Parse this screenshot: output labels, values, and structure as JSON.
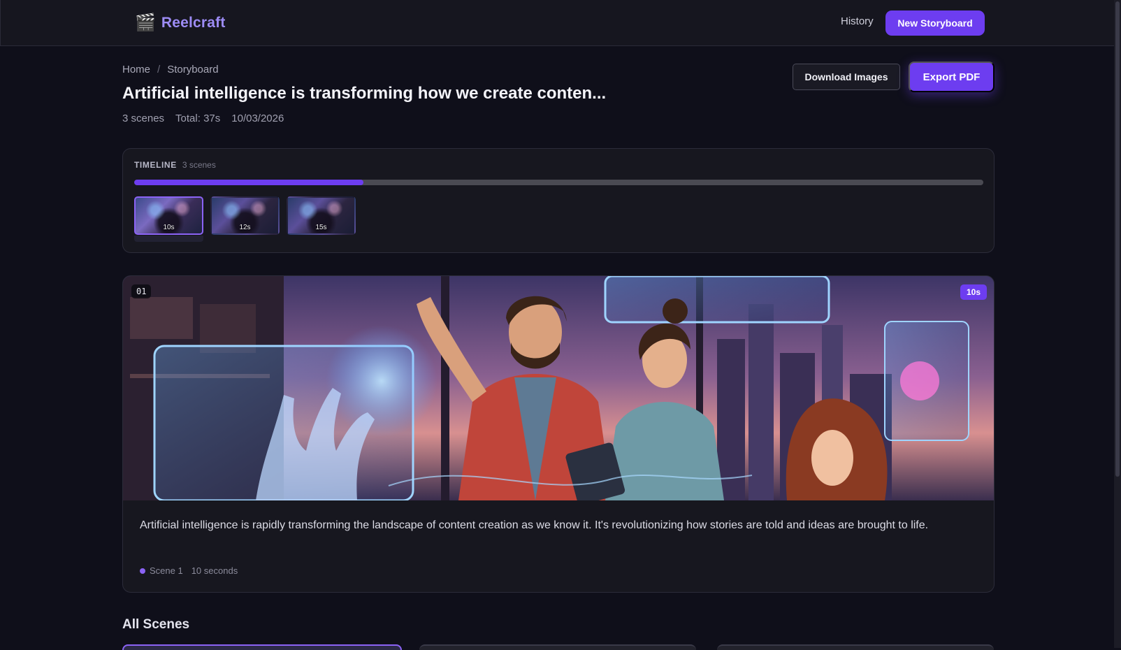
{
  "header": {
    "brand_icon": "🎬",
    "brand_name": "Reelcraft",
    "nav_history": "History",
    "new_storyboard": "New Storyboard"
  },
  "breadcrumb": {
    "home": "Home",
    "separator": "/",
    "current": "Storyboard"
  },
  "storyboard": {
    "title": "Artificial intelligence is transforming how we create conten...",
    "scene_count": "3 scenes",
    "total": "Total: 37s",
    "date": "10/03/2026"
  },
  "actions": {
    "download": "Download Images",
    "export": "Export PDF"
  },
  "timeline": {
    "label": "TIMELINE",
    "count": "3 scenes",
    "progress_fraction": 0.27,
    "thumbs": [
      {
        "duration": "10s",
        "active": true
      },
      {
        "duration": "12s",
        "active": false
      },
      {
        "duration": "15s",
        "active": false
      }
    ]
  },
  "current_scene": {
    "number": "01",
    "duration_badge": "10s",
    "text": "Artificial intelligence is rapidly transforming the landscape of content creation as we know it. It's revolutionizing how stories are told and ideas are brought to life.",
    "scene_label": "Scene 1",
    "duration_label": "10 seconds"
  },
  "all_scenes": {
    "heading": "All Scenes"
  },
  "colors": {
    "accent": "#6d3df0",
    "accent_light": "#8b63f5",
    "background": "#0f0f1a",
    "card": "#17171f"
  }
}
